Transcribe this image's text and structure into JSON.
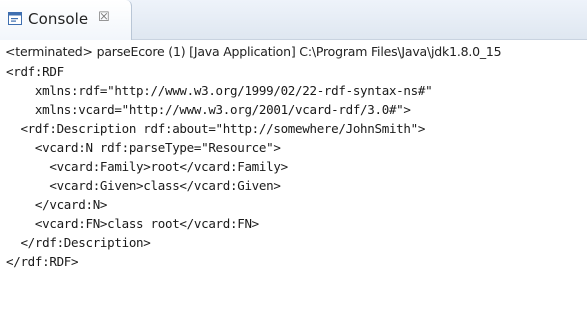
{
  "tab": {
    "icon": "console-icon",
    "label": "Console",
    "close_glyph": "☒"
  },
  "status_line": "<terminated> parseEcore (1) [Java Application] C:\\Program Files\\Java\\jdk1.8.0_15",
  "code_lines": [
    "<rdf:RDF",
    "    xmlns:rdf=\"http://www.w3.org/1999/02/22-rdf-syntax-ns#\"",
    "    xmlns:vcard=\"http://www.w3.org/2001/vcard-rdf/3.0#\">",
    "  <rdf:Description rdf:about=\"http://somewhere/JohnSmith\">",
    "    <vcard:N rdf:parseType=\"Resource\">",
    "      <vcard:Family>root</vcard:Family>",
    "      <vcard:Given>class</vcard:Given>",
    "    </vcard:N>",
    "    <vcard:FN>class root</vcard:FN>",
    "  </rdf:Description>",
    "</rdf:RDF>"
  ],
  "colors": {
    "tab_bar_top": "#eef3fa",
    "tab_bar_bottom": "#dfe7f1",
    "icon_blue": "#3f6fb0",
    "text": "#1a1a1a"
  }
}
